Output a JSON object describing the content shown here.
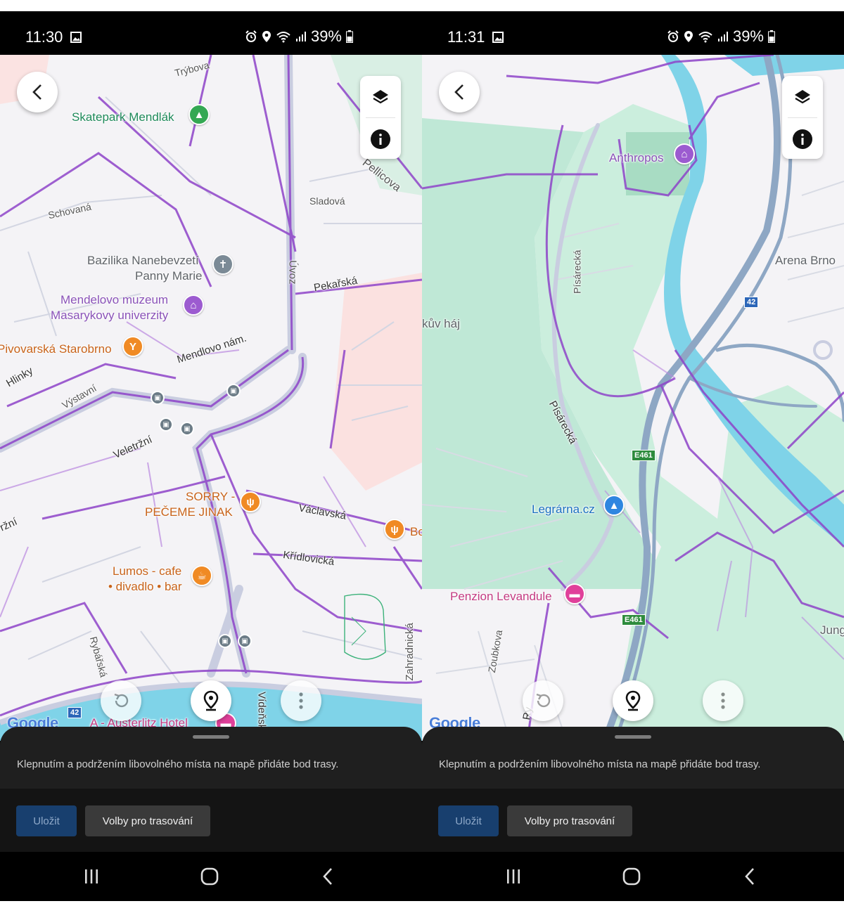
{
  "screens": [
    {
      "status": {
        "time": "11:30",
        "battery": "39%"
      },
      "map": {
        "streets": [
          "Trýbova",
          "Schovaná",
          "Sladová",
          "Pellicova",
          "Úvoz",
          "Pekařská",
          "Mendlovo nám.",
          "Hlinky",
          "Výstavní",
          "Veletržní",
          "ržní",
          "Václavská",
          "Křídlovická",
          "Rybářská",
          "Zahradnická",
          "Vídeňská"
        ],
        "places": {
          "skatepark": "Skatepark Mendlák",
          "bazilika_1": "Bazilika Nanebevzetí",
          "bazilika_2": "Panny Marie",
          "muzeum_1": "Mendelovo muzeum",
          "muzeum_2": "Masarykovy univerzity",
          "pivovarska": "Pivovarská Starobrno",
          "sorry_1": "SORRY -",
          "sorry_2": "PEČEME JINAK",
          "lumos_1": "Lumos - cafe",
          "lumos_2": "• divadlo • bar",
          "bo": "Bo",
          "hotel": "A - Austerlitz Hotel"
        },
        "shields": [
          "42"
        ]
      }
    },
    {
      "status": {
        "time": "11:31",
        "battery": "39%"
      },
      "map": {
        "streets": [
          "Písárecká",
          "Písárecká",
          "Zoubkova",
          "Ry",
          "kův háj"
        ],
        "places": {
          "anthropos": "Anthropos",
          "arena": "Arena Brno",
          "legrarna": "Legrárna.cz",
          "penzion": "Penzion Levandule",
          "jung": "Jung"
        },
        "shields": [
          "42",
          "E461",
          "E461"
        ]
      }
    }
  ],
  "common": {
    "google_logo": "Google",
    "hint": "Klepnutím a podržením libovolného místa na mapě přidáte bod trasy.",
    "save_label": "Uložit",
    "options_label": "Volby pro trasování",
    "colors": {
      "route": "#8e44c9",
      "road_major": "#c9cde0",
      "water": "#7fd3e8",
      "park": "#bfe8d6",
      "sheet": "#1f1f1f",
      "save_button": "#183f6e"
    }
  }
}
